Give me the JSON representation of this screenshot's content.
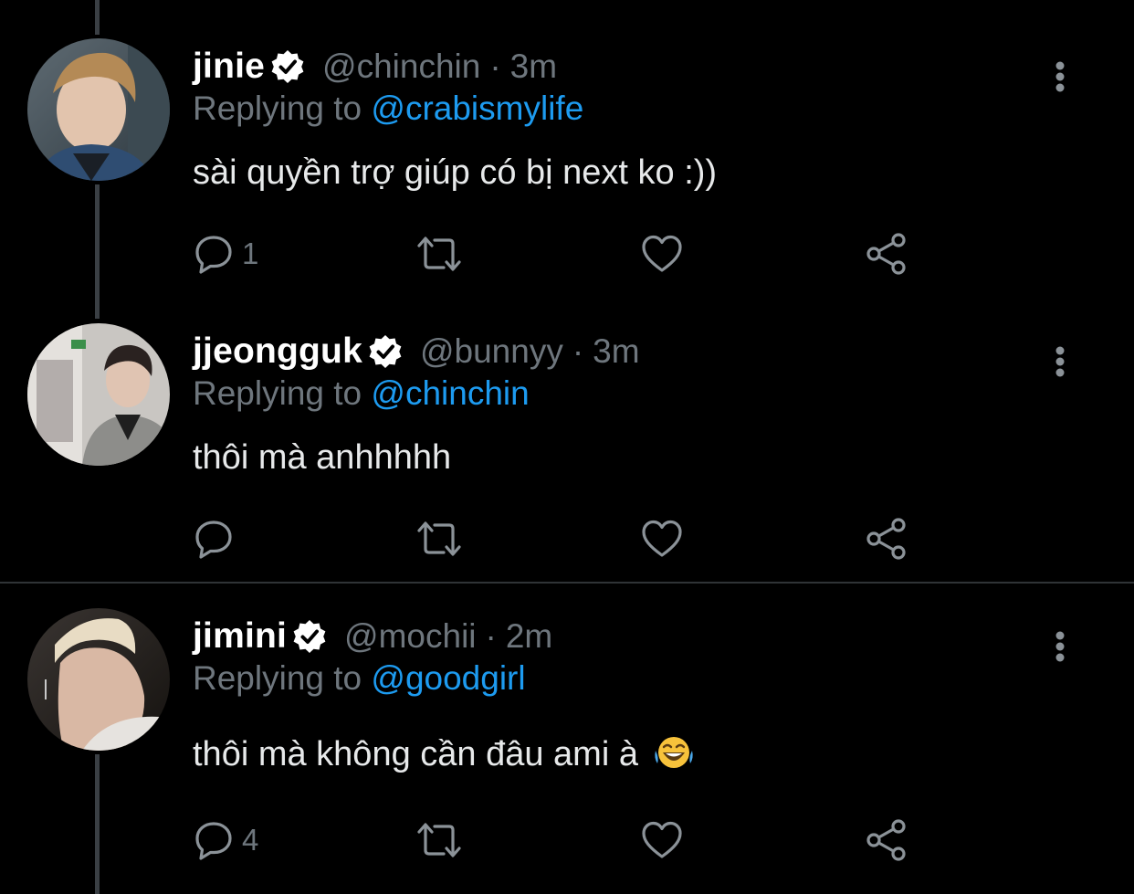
{
  "tweets": [
    {
      "display_name": "jinie",
      "handle": "@chinchin",
      "separator": "·",
      "time": "3m",
      "reply_prefix": "Replying to",
      "reply_to": "@crabismylife",
      "text": "sài quyền trợ giúp có bị next ko :))",
      "reply_count": "1",
      "retweet_count": "",
      "like_count": ""
    },
    {
      "display_name": "jjeongguk",
      "handle": "@bunnyy",
      "separator": "·",
      "time": "3m",
      "reply_prefix": "Replying to",
      "reply_to": "@chinchin",
      "text": "thôi mà anhhhhh",
      "reply_count": "",
      "retweet_count": "",
      "like_count": ""
    },
    {
      "display_name": "jimini",
      "handle": "@mochii",
      "separator": "·",
      "time": "2m",
      "reply_prefix": "Replying to",
      "reply_to": "@goodgirl",
      "text": "thôi mà không cần đâu ami à",
      "emoji": "face-with-tears-of-joy",
      "reply_count": "4",
      "retweet_count": "",
      "like_count": ""
    }
  ],
  "icons": {
    "verified": "verified-badge-icon",
    "more": "more-vertical-icon",
    "reply": "reply-bubble-icon",
    "retweet": "retweet-icon",
    "like": "heart-icon",
    "share": "share-icon"
  },
  "colors": {
    "background": "#000000",
    "primary_text": "#e7e9ea",
    "secondary_text": "#6e767d",
    "link": "#1d9bf0",
    "thread_line": "#3a3f44",
    "divider": "#2f3336"
  }
}
